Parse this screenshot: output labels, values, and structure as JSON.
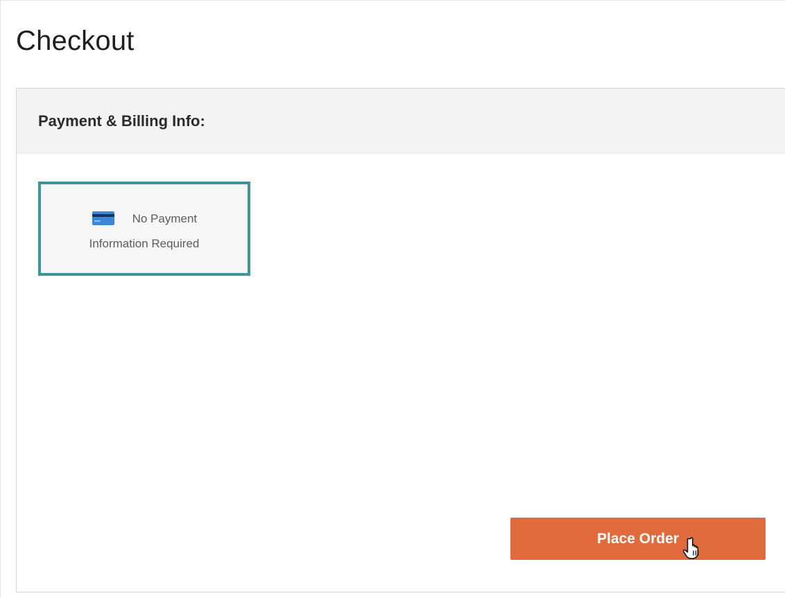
{
  "page": {
    "title": "Checkout"
  },
  "payment_panel": {
    "title": "Payment & Billing Info:",
    "option": {
      "icon": "credit-card-icon",
      "line1": "No Payment",
      "line2": "Information Required"
    }
  },
  "actions": {
    "place_order_label": "Place Order",
    "cursor": "hand-pointer-icon"
  },
  "colors": {
    "accent_orange": "#e06b3c",
    "selected_border": "#3f9496",
    "card_icon_blue": "#3d86d6",
    "header_background": "#f3f3f2"
  }
}
